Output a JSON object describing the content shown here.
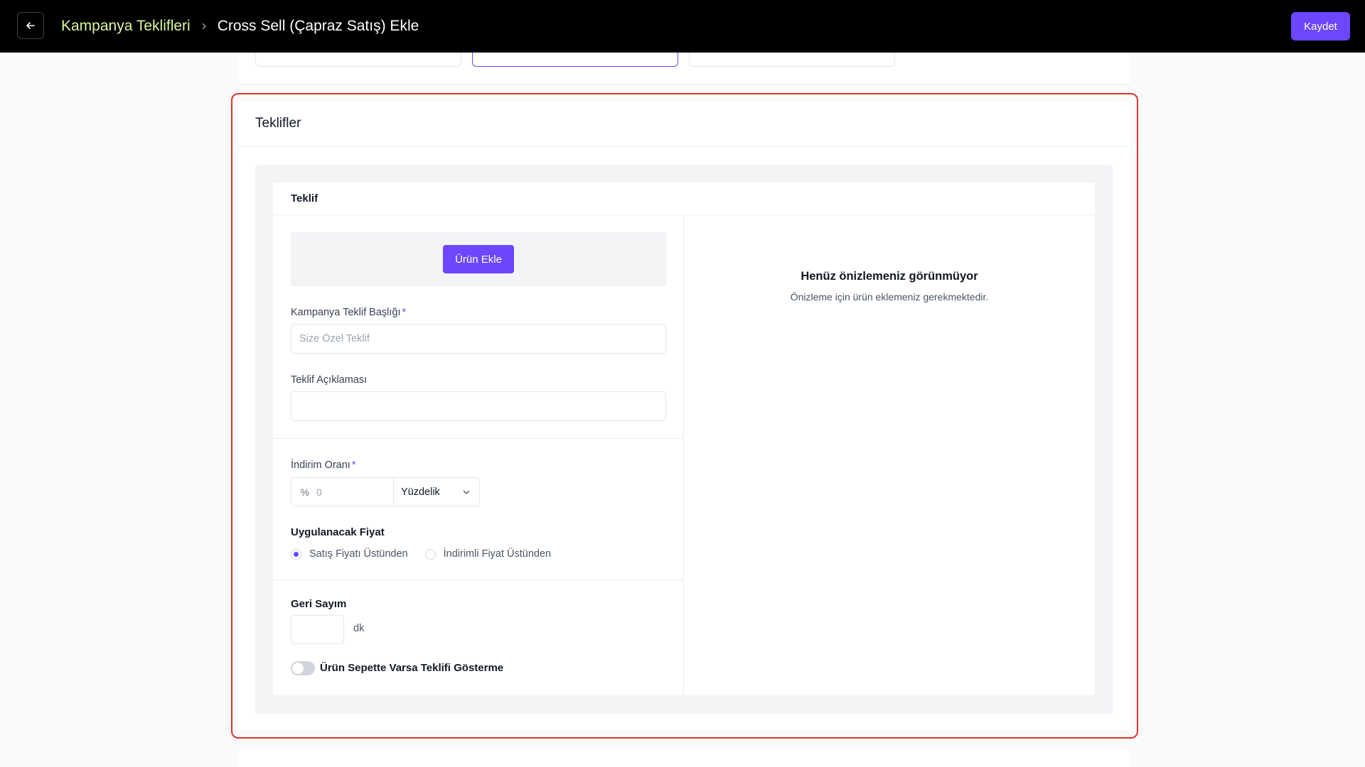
{
  "header": {
    "breadcrumb_parent": "Kampanya Teklifleri",
    "breadcrumb_current": "Cross Sell (Çapraz Satış) Ekle",
    "save_label": "Kaydet",
    "back_icon": "arrow-left-icon",
    "separator_icon": "chevron-right-icon"
  },
  "offers_section": {
    "title": "Teklifler",
    "offer_card": {
      "title": "Teklif",
      "add_product_label": "Ürün Ekle",
      "campaign_title_label": "Kampanya Teklif Başlığı",
      "campaign_title_required": "*",
      "campaign_title_placeholder": "Size Özel Teklif",
      "description_label": "Teklif Açıklaması",
      "description_value": "",
      "discount_label": "İndirim Oranı",
      "discount_required": "*",
      "discount_prefix": "%",
      "discount_placeholder": "0",
      "discount_type": "Yüzdelik",
      "price_label": "Uygulanacak Fiyat",
      "price_options": [
        {
          "label": "Satış Fiyatı Üstünden",
          "checked": true
        },
        {
          "label": "İndirimli Fiyat Üstünden",
          "checked": false
        }
      ],
      "countdown_label": "Geri Sayım",
      "countdown_value": "",
      "countdown_unit": "dk",
      "hide_if_in_cart_label": "Ürün Sepette Varsa Teklifi Gösterme",
      "hide_if_in_cart_enabled": false
    },
    "preview": {
      "title": "Henüz önizlemeniz görünmüyor",
      "subtitle": "Önizleme için ürün eklemeniz gerekmektedir."
    }
  },
  "colors": {
    "accent": "#6c47ff",
    "breadcrumb_link": "#d9f99d",
    "highlight_border": "#e5332a",
    "topbar": "#000000"
  }
}
